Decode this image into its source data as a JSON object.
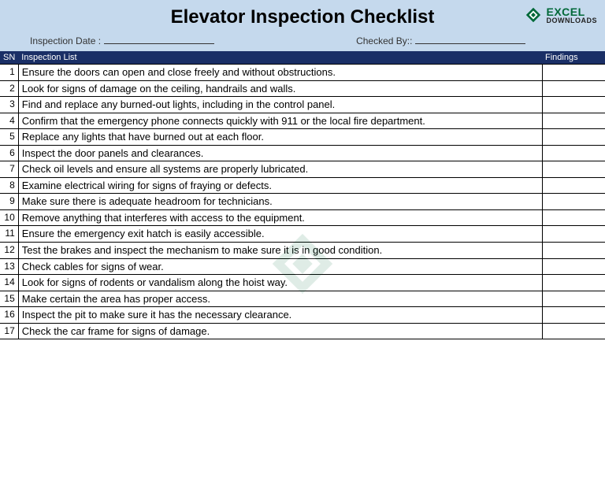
{
  "title": "Elevator Inspection Checklist",
  "logo": {
    "top": "EXCEL",
    "bottom": "DOWNLOADS"
  },
  "meta": {
    "date_label": "Inspection Date :",
    "checked_label": "Checked By::"
  },
  "columns": {
    "sn": "SN",
    "list": "Inspection List",
    "findings": "Findings"
  },
  "items": [
    {
      "n": "1",
      "text": "Ensure the doors can open and close freely and without obstructions.",
      "findings": ""
    },
    {
      "n": "2",
      "text": "Look for signs of damage on the ceiling, handrails and walls.",
      "findings": ""
    },
    {
      "n": "3",
      "text": "Find and replace any burned-out lights, including in the control panel.",
      "findings": ""
    },
    {
      "n": "4",
      "text": "Confirm that the emergency phone connects quickly with 911 or the local fire department.",
      "findings": ""
    },
    {
      "n": "5",
      "text": "Replace any lights that have burned out at each floor.",
      "findings": ""
    },
    {
      "n": "6",
      "text": "Inspect the door panels and clearances.",
      "findings": ""
    },
    {
      "n": "7",
      "text": "Check oil levels and ensure all systems are properly lubricated.",
      "findings": ""
    },
    {
      "n": "8",
      "text": "Examine electrical wiring for signs of fraying or defects.",
      "findings": ""
    },
    {
      "n": "9",
      "text": "Make sure there is adequate headroom for technicians.",
      "findings": ""
    },
    {
      "n": "10",
      "text": "Remove anything that interferes with access to the equipment.",
      "findings": ""
    },
    {
      "n": "11",
      "text": "Ensure the emergency exit hatch is easily accessible.",
      "findings": ""
    },
    {
      "n": "12",
      "text": "Test the brakes and inspect the mechanism to make sure it is in good condition.",
      "findings": ""
    },
    {
      "n": "13",
      "text": "Check cables for signs of wear.",
      "findings": ""
    },
    {
      "n": "14",
      "text": "Look for signs of rodents or vandalism along the hoist way.",
      "findings": ""
    },
    {
      "n": "15",
      "text": "Make certain the area has proper access.",
      "findings": ""
    },
    {
      "n": "16",
      "text": "Inspect the pit to make sure it has the necessary clearance.",
      "findings": ""
    },
    {
      "n": "17",
      "text": "Check the car frame for signs of damage.",
      "findings": ""
    }
  ]
}
